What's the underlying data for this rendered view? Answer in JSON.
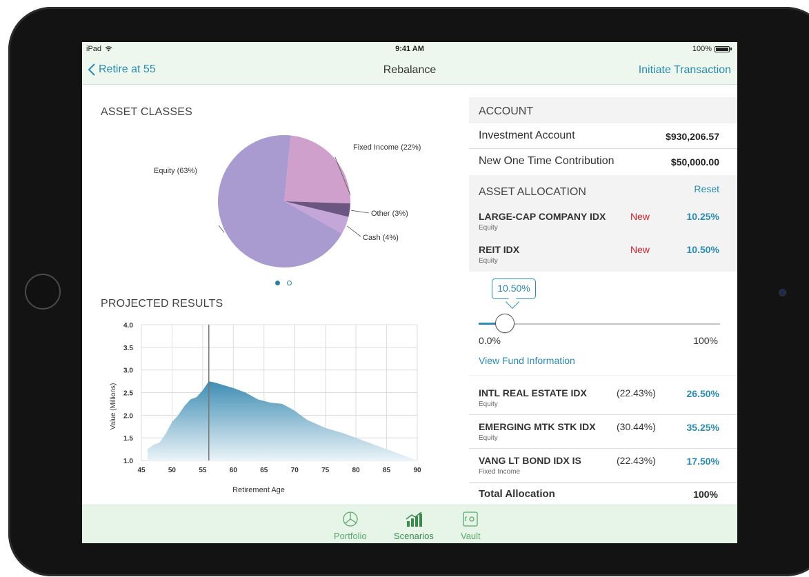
{
  "status_bar": {
    "carrier": "iPad",
    "time": "9:41 AM",
    "battery": "100%"
  },
  "nav": {
    "back_label": "Retire at 55",
    "title": "Rebalance",
    "action_label": "Initiate Transaction"
  },
  "asset_classes": {
    "heading": "ASSET CLASSES",
    "slices": [
      {
        "label": "Equity (63%)",
        "value": 63,
        "color": "#a99ad0"
      },
      {
        "label": "Fixed Income (22%)",
        "value": 22,
        "color": "#cfa0cb"
      },
      {
        "label": "Other (3%)",
        "value": 3,
        "color": "#6b5581"
      },
      {
        "label": "Cash (4%)",
        "value": 4,
        "color": "#c4a6d8"
      }
    ],
    "page_dots": 2,
    "active_dot": 0
  },
  "projected": {
    "heading": "PROJECTED RESULTS"
  },
  "chart_data": {
    "type": "area",
    "xlabel": "Retirement Age",
    "ylabel": "Value (Millions)",
    "xlim": [
      45,
      90
    ],
    "ylim": [
      1.0,
      4.0
    ],
    "x_ticks": [
      "45",
      "50",
      "55",
      "60",
      "65",
      "70",
      "75",
      "80",
      "85",
      "90"
    ],
    "y_ticks": [
      "1.0",
      "1.5",
      "2.0",
      "2.5",
      "3.0",
      "3.5",
      "4.0"
    ],
    "marker_x": 56,
    "grid": true,
    "x": [
      46,
      47,
      48,
      49,
      50,
      51,
      52,
      53,
      54,
      55,
      56,
      57,
      58,
      60,
      62,
      64,
      66,
      68,
      70,
      72,
      75,
      78,
      82,
      85,
      88,
      90
    ],
    "y": [
      1.25,
      1.35,
      1.4,
      1.6,
      1.85,
      2.0,
      2.2,
      2.35,
      2.4,
      2.55,
      2.75,
      2.72,
      2.68,
      2.6,
      2.5,
      2.35,
      2.28,
      2.25,
      2.1,
      1.9,
      1.72,
      1.6,
      1.4,
      1.25,
      1.1,
      1.0
    ]
  },
  "account": {
    "heading": "ACCOUNT",
    "rows": [
      {
        "label": "Investment Account",
        "value": "$930,206.57"
      },
      {
        "label": "New One Time Contribution",
        "value": "$50,000.00"
      }
    ]
  },
  "allocation": {
    "heading": "ASSET ALLOCATION",
    "reset_label": "Reset",
    "new_funds": [
      {
        "name": "LARGE-CAP COMPANY IDX",
        "type": "Equity",
        "badge": "New",
        "pct": "10.25%"
      },
      {
        "name": "REIT IDX",
        "type": "Equity",
        "badge": "New",
        "pct": "10.50%"
      }
    ],
    "slider": {
      "value_label": "10.50%",
      "value": 10.5,
      "min_label": "0.0%",
      "max_label": "100%"
    },
    "view_fund_link": "View Fund Information",
    "funds": [
      {
        "name": "INTL REAL ESTATE IDX",
        "type": "Equity",
        "old": "(22.43%)",
        "pct": "26.50%"
      },
      {
        "name": "EMERGING MTK STK IDX",
        "type": "Equity",
        "old": "(30.44%)",
        "pct": "35.25%"
      },
      {
        "name": "VANG LT BOND IDX IS",
        "type": "Fixed Income",
        "old": "(22.43%)",
        "pct": "17.50%"
      }
    ],
    "total_label": "Total Allocation",
    "total_value": "100%"
  },
  "tabs": [
    {
      "label": "Portfolio",
      "icon": "pie-chart-icon"
    },
    {
      "label": "Scenarios",
      "icon": "bar-chart-icon"
    },
    {
      "label": "Vault",
      "icon": "vault-icon"
    }
  ],
  "colors": {
    "accent": "#2b8bb0",
    "new_badge": "#d0202c",
    "tint": "#edf7ee",
    "tab_active": "#3a8a4c"
  }
}
